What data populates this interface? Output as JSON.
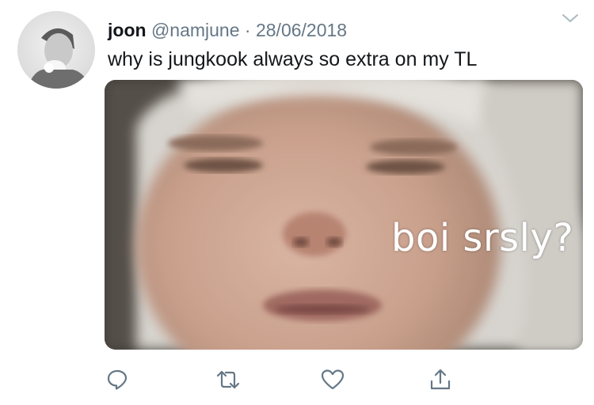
{
  "tweet": {
    "display_name": "joon",
    "handle": "@namjune",
    "separator": "·",
    "date": "28/06/2018",
    "text": "why is jungkook always so extra on my TL"
  },
  "media": {
    "caption": "boi srsly?"
  },
  "icons": {
    "caret": "chevron-down-icon",
    "reply": "reply-icon",
    "retweet": "retweet-icon",
    "like": "heart-icon",
    "share": "share-icon"
  },
  "colors": {
    "text_primary": "#14171a",
    "text_secondary": "#657786",
    "icon": "#657786"
  }
}
